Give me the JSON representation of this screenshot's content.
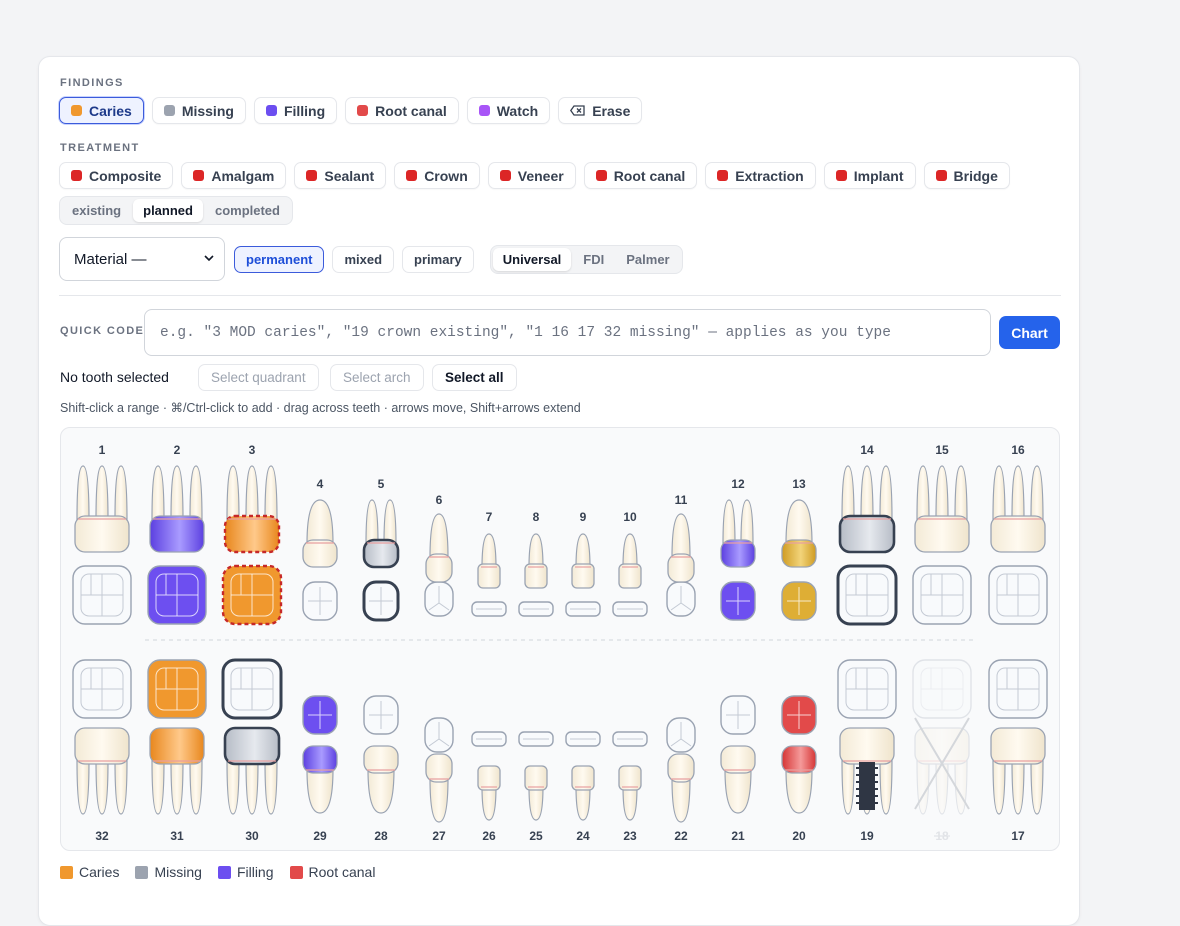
{
  "findings": {
    "label": "FINDINGS",
    "chips": [
      {
        "label": "Caries",
        "color": "#f0982e",
        "active": true
      },
      {
        "label": "Missing",
        "color": "#9ca3af",
        "active": false
      },
      {
        "label": "Filling",
        "color": "#6c4ef0",
        "active": false
      },
      {
        "label": "Root canal",
        "color": "#e24a4a",
        "active": false
      },
      {
        "label": "Watch",
        "color": "#a855f7",
        "active": false
      }
    ],
    "erase_label": "Erase"
  },
  "treatment": {
    "label": "TREATMENT",
    "chips": [
      {
        "label": "Composite",
        "color": "#dc2626"
      },
      {
        "label": "Amalgam",
        "color": "#dc2626"
      },
      {
        "label": "Sealant",
        "color": "#dc2626"
      },
      {
        "label": "Crown",
        "color": "#dc2626"
      },
      {
        "label": "Veneer",
        "color": "#dc2626"
      },
      {
        "label": "Root canal",
        "color": "#dc2626"
      },
      {
        "label": "Extraction",
        "color": "#dc2626"
      },
      {
        "label": "Implant",
        "color": "#dc2626"
      },
      {
        "label": "Bridge",
        "color": "#dc2626"
      }
    ],
    "status": {
      "options": [
        "existing",
        "planned",
        "completed"
      ],
      "selected": "planned"
    }
  },
  "controls": {
    "material_label": "Material —",
    "dentition": {
      "options": [
        "permanent",
        "mixed",
        "primary"
      ],
      "selected": "permanent"
    },
    "numbering": {
      "options": [
        "Universal",
        "FDI",
        "Palmer"
      ],
      "selected": "Universal"
    }
  },
  "quick_code": {
    "label": "QUICK CODE",
    "placeholder": "e.g. \"3 MOD caries\", \"19 crown existing\", \"1 16 17 32 missing\" — applies as you type",
    "button": "Chart"
  },
  "selection": {
    "status": "No tooth selected",
    "buttons": {
      "quadrant": "Select quadrant",
      "arch": "Select arch",
      "all": "Select all"
    },
    "hint": "Shift-click a range · ⌘/Ctrl-click to add · drag across teeth · arrows move, Shift+arrows extend"
  },
  "chart": {
    "upper": [
      {
        "num": "1",
        "kind": "molar"
      },
      {
        "num": "2",
        "kind": "molar",
        "crown": "filling",
        "occlusal": "filling"
      },
      {
        "num": "3",
        "kind": "molar",
        "crown": "caries-dashed",
        "occlusal": "caries-dashed"
      },
      {
        "num": "4",
        "kind": "premolar1"
      },
      {
        "num": "5",
        "kind": "premolar2",
        "crown": "crown-gray",
        "occlusal": "crown-outline"
      },
      {
        "num": "6",
        "kind": "canine"
      },
      {
        "num": "7",
        "kind": "incisor"
      },
      {
        "num": "8",
        "kind": "incisor"
      },
      {
        "num": "9",
        "kind": "incisor"
      },
      {
        "num": "10",
        "kind": "incisor"
      },
      {
        "num": "11",
        "kind": "canine"
      },
      {
        "num": "12",
        "kind": "premolar2",
        "crown": "filling",
        "occlusal": "filling"
      },
      {
        "num": "13",
        "kind": "premolar1",
        "crown": "gold",
        "occlusal": "gold"
      },
      {
        "num": "14",
        "kind": "molar",
        "crown": "crown-gray",
        "occlusal": "crown-outline"
      },
      {
        "num": "15",
        "kind": "molar"
      },
      {
        "num": "16",
        "kind": "molar"
      }
    ],
    "lower": [
      {
        "num": "32",
        "kind": "molar"
      },
      {
        "num": "31",
        "kind": "molar",
        "crown": "caries",
        "occlusal": "caries"
      },
      {
        "num": "30",
        "kind": "molar",
        "crown": "crown-gray",
        "occlusal": "crown-outline"
      },
      {
        "num": "29",
        "kind": "premolar",
        "crown": "filling",
        "occlusal": "filling"
      },
      {
        "num": "28",
        "kind": "premolar"
      },
      {
        "num": "27",
        "kind": "canine"
      },
      {
        "num": "26",
        "kind": "incisor"
      },
      {
        "num": "25",
        "kind": "incisor"
      },
      {
        "num": "24",
        "kind": "incisor"
      },
      {
        "num": "23",
        "kind": "incisor"
      },
      {
        "num": "22",
        "kind": "canine"
      },
      {
        "num": "21",
        "kind": "premolar"
      },
      {
        "num": "20",
        "kind": "premolar",
        "crown": "rootcanal",
        "occlusal": "rootcanal"
      },
      {
        "num": "19",
        "kind": "molar",
        "implant": true
      },
      {
        "num": "18",
        "kind": "molar",
        "missing": true
      },
      {
        "num": "17",
        "kind": "molar"
      }
    ]
  },
  "legend": [
    {
      "label": "Caries",
      "color": "#f0982e"
    },
    {
      "label": "Missing",
      "color": "#9ca3af"
    },
    {
      "label": "Filling",
      "color": "#6c4ef0"
    },
    {
      "label": "Root canal",
      "color": "#e24a4a"
    }
  ]
}
